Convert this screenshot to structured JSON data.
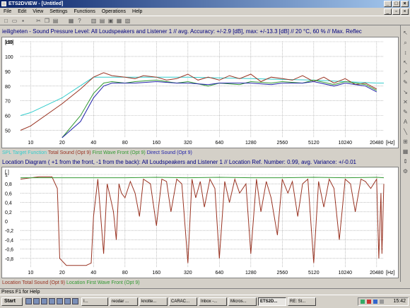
{
  "window": {
    "title": "ETS2DVIEW - [Untitled]",
    "minimize": "_",
    "maximize": "□",
    "close": "×"
  },
  "menu": [
    "File",
    "Edit",
    "View",
    "Settings",
    "Functions",
    "Operations",
    "Help"
  ],
  "inner_window": {
    "minimize": "_",
    "restore": "▫",
    "close": "×"
  },
  "chart1": {
    "title": "ieiligheten - Sound Pressure Level:  All Loudspeakers and Listener 1 // avg. Accuracy: +/-2.9 [dB], max: +/-13.3 [dB] // 20 °C, 60 % // Max. Reflec",
    "unit": "[dB]",
    "legend": [
      "SPL Target Function",
      "Total Sound (Opt 9)",
      "First Wave Front (Opt 9)",
      "Direct Sound (Opt 9)"
    ],
    "colors": {
      "target": "#33cccc",
      "total": "#993322",
      "first": "#339933",
      "direct": "#2222aa"
    }
  },
  "chart2": {
    "title": "Location Diagram ( +1 from the front, -1 from the back):  All Loudspeakers and Listener 1 // Location Ref. Number: 0.99, avg. Variance: +/-0.01",
    "unit": "[ ]",
    "legend": [
      "Location Total Sound (Opt 9)",
      "Location First Wave Front (Opt 9)"
    ],
    "colors": {
      "total": "#993322",
      "first": "#339933"
    }
  },
  "chart_data": [
    {
      "type": "line",
      "title": "Sound Pressure Level",
      "xscale": "log",
      "xlabel": "[Hz]",
      "ylabel": "[dB]",
      "xlim": [
        8,
        24000
      ],
      "ylim": [
        45,
        110
      ],
      "x_ticks": [
        10,
        20,
        40,
        80,
        160,
        320,
        640,
        1280,
        2560,
        5120,
        10240,
        20480
      ],
      "x_tick_labels": [
        "10",
        "20",
        "40",
        "80",
        "160",
        "320",
        "640",
        "1280",
        "2560",
        "5120",
        "10240",
        "20480"
      ],
      "y_ticks": [
        50,
        60,
        70,
        80,
        90,
        100,
        110
      ],
      "grid": true,
      "series": [
        {
          "name": "SPL Target Function",
          "x": [
            8,
            10,
            20,
            40,
            80,
            160,
            320,
            640,
            1280,
            2560,
            5120,
            10240,
            20480,
            24000
          ],
          "y": [
            60,
            62,
            72,
            86,
            86,
            86,
            86,
            85.5,
            85,
            84.5,
            84,
            83,
            82,
            82
          ]
        },
        {
          "name": "Total Sound (Opt 9)",
          "x": [
            8,
            10,
            20,
            30,
            40,
            50,
            60,
            80,
            100,
            120,
            160,
            200,
            250,
            320,
            400,
            500,
            640,
            800,
            1000,
            1280,
            1600,
            2000,
            2560,
            3200,
            4000,
            5120,
            6400,
            8000,
            10240,
            12800,
            16000,
            20480
          ],
          "y": [
            50,
            53,
            68,
            78,
            86,
            89,
            87,
            86,
            85,
            87,
            86,
            84,
            85,
            88,
            84,
            86,
            84,
            87,
            85,
            88,
            83,
            86,
            85,
            84,
            87,
            83,
            86,
            82,
            85,
            81,
            82,
            78
          ]
        },
        {
          "name": "First Wave Front (Opt 9)",
          "x": [
            20,
            30,
            40,
            50,
            60,
            80,
            100,
            160,
            250,
            320,
            500,
            640,
            1000,
            1280,
            2000,
            2560,
            4000,
            5120,
            8000,
            10240,
            16000,
            20480
          ],
          "y": [
            45,
            60,
            75,
            82,
            83,
            82,
            83,
            84,
            82,
            83,
            80,
            82,
            81,
            83,
            82,
            83,
            82,
            84,
            81,
            83,
            81,
            77
          ]
        },
        {
          "name": "Direct Sound (Opt 9)",
          "x": [
            20,
            30,
            40,
            50,
            60,
            80,
            100,
            160,
            250,
            320,
            500,
            640,
            1000,
            1280,
            2000,
            2560,
            4000,
            5120,
            8000,
            10240,
            16000,
            20480
          ],
          "y": [
            45,
            56,
            72,
            80,
            82,
            82,
            82,
            83,
            82,
            82,
            81,
            82,
            82,
            82,
            81,
            82,
            82,
            83,
            80,
            82,
            80,
            76
          ]
        }
      ]
    },
    {
      "type": "line",
      "title": "Location Diagram",
      "xscale": "log",
      "xlabel": "[Hz]",
      "ylabel": "[ ]",
      "xlim": [
        8,
        24000
      ],
      "ylim": [
        -1,
        1
      ],
      "x_ticks": [
        10,
        20,
        40,
        80,
        160,
        320,
        640,
        1280,
        2560,
        5120,
        10240,
        20480
      ],
      "x_tick_labels": [
        "10",
        "20",
        "40",
        "80",
        "160",
        "320",
        "640",
        "1280",
        "2560",
        "5120",
        "10240",
        "20480"
      ],
      "y_ticks": [
        -0.8,
        -0.6,
        -0.4,
        -0.2,
        0,
        0.2,
        0.4,
        0.6,
        0.8,
        1
      ],
      "y_tick_labels": [
        "-0,8",
        "-0,6",
        "-0,4",
        "-0,2",
        "0",
        "0,2",
        "0,4",
        "0,6",
        "0,8",
        "1"
      ],
      "grid": true,
      "series": [
        {
          "name": "Location Total Sound (Opt 9)",
          "x": [
            8,
            12,
            16,
            18,
            19,
            22,
            28,
            34,
            38,
            40,
            44,
            50,
            54,
            58,
            62,
            66,
            70,
            74,
            80,
            90,
            100,
            110,
            120,
            140,
            160,
            180,
            200,
            220,
            250,
            280,
            320,
            350,
            380,
            420,
            460,
            520,
            580,
            640,
            720,
            800,
            900,
            1000,
            1150,
            1280,
            1450,
            1600,
            1800,
            2000,
            2300,
            2560,
            2900,
            3200,
            3600,
            4000,
            4500,
            5120,
            5700,
            6400,
            7200,
            8000,
            9000,
            10240,
            11500,
            12800,
            14500,
            16000,
            18000,
            20480,
            21500,
            22500,
            23000,
            24000
          ],
          "y": [
            0.9,
            0.95,
            0.95,
            0.7,
            -0.8,
            -0.95,
            -0.95,
            -0.95,
            -0.9,
            0.1,
            0.9,
            -0.7,
            0.8,
            0.5,
            0.2,
            -0.4,
            0.8,
            0.6,
            0.5,
            0.85,
            0.6,
            0.1,
            0.9,
            0.8,
            -0.1,
            0.9,
            0.85,
            0.2,
            0.9,
            0.8,
            -0.9,
            0.9,
            0.5,
            0.85,
            0.3,
            0.9,
            0.7,
            -0.8,
            0.85,
            0.4,
            0.9,
            0.6,
            0.8,
            -0.7,
            0.9,
            0.2,
            0.85,
            0.5,
            -0.3,
            0.9,
            0.6,
            0.85,
            0.1,
            0.8,
            0.9,
            -0.9,
            0.85,
            0.3,
            0.9,
            0.7,
            -0.4,
            0.9,
            0.8,
            0.2,
            0.9,
            0.85,
            0.7,
            0.9,
            -0.8,
            0.6,
            -0.7,
            0.8
          ]
        },
        {
          "name": "Location First Wave Front (Opt 9)",
          "x": [
            8,
            20,
            40,
            80,
            160,
            320,
            640,
            1280,
            2560,
            5120,
            10240,
            20480,
            24000
          ],
          "y": [
            0.93,
            0.93,
            0.93,
            0.93,
            0.94,
            0.93,
            0.94,
            0.93,
            0.93,
            0.94,
            0.93,
            0.94,
            0.93
          ]
        }
      ]
    }
  ],
  "status": "Press F1 for Help",
  "taskbar": {
    "start": "Start",
    "tasks": [
      "I...",
      "reodar ...",
      "knotte...",
      "CARAC...",
      "Inbox -...",
      "Micros...",
      "ETS2D...",
      "RE: St..."
    ],
    "clock": "15:42"
  }
}
